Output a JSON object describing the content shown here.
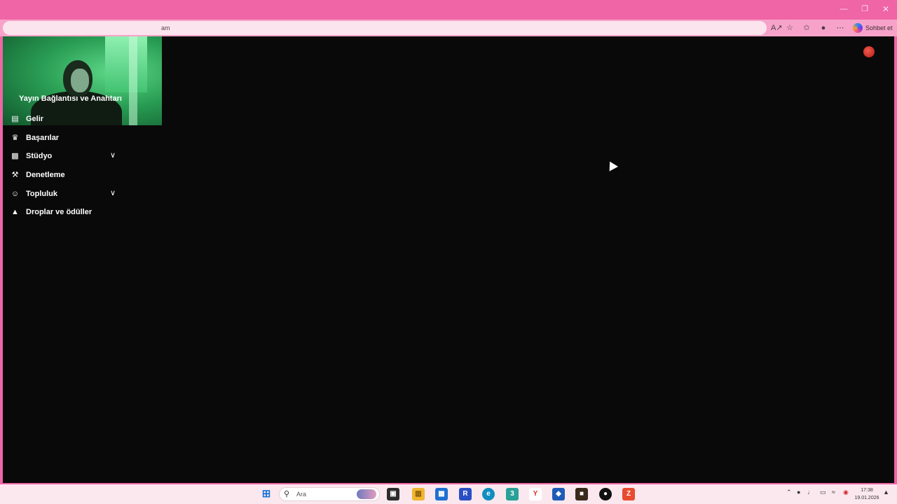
{
  "browser": {
    "url_fragment": "am",
    "copilot_label": "Sohbet et"
  },
  "sidebar": {
    "heading": "Yayın Bağlantısı ve Anahtarı",
    "items": [
      {
        "label": "Gelir",
        "icon": "chart-icon",
        "expandable": false
      },
      {
        "label": "Başarılar",
        "icon": "trophy-icon",
        "expandable": false
      },
      {
        "label": "Stüdyo",
        "icon": "studio-icon",
        "expandable": true
      },
      {
        "label": "Denetleme",
        "icon": "wrench-icon",
        "expandable": false
      },
      {
        "label": "Topluluk",
        "icon": "community-icon",
        "expandable": true
      },
      {
        "label": "Droplar ve ödüller",
        "icon": "drops-icon",
        "expandable": false
      }
    ]
  },
  "taskbar": {
    "search_placeholder": "Ara",
    "time": "17:38",
    "date": "19.01.2026"
  },
  "colors": {
    "frame": "#f065a5",
    "content_bg": "#0a090a",
    "taskbar": "#fbe8ef"
  }
}
